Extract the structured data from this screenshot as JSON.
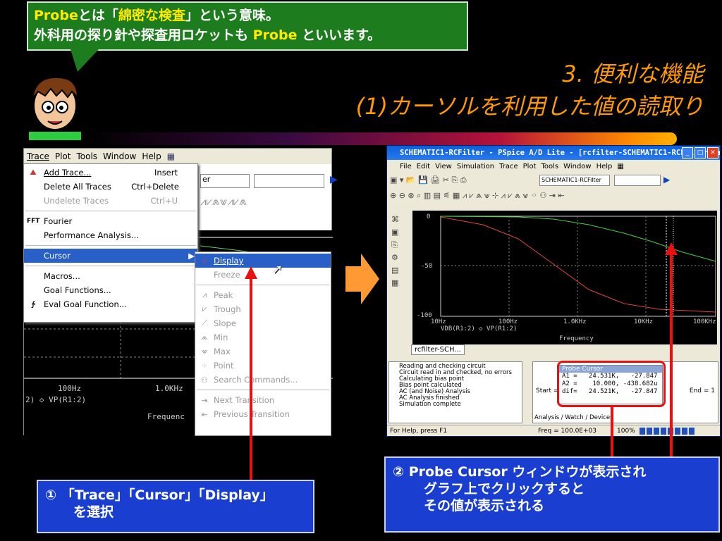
{
  "callout": {
    "line1_a": "Probe",
    "line1_b": "とは「",
    "line1_c": "綿密な検査",
    "line1_d": "」という意味。",
    "line2_a": "外科用の探り針や探査用ロケットも ",
    "line2_b": "Probe",
    "line2_c": " といいます。"
  },
  "title": {
    "line1": "3. 便利な機能",
    "line2": "(1)カーソルを利用した値の読取り"
  },
  "left_window": {
    "menubar": [
      "Trace",
      "Plot",
      "Tools",
      "Window",
      "Help"
    ],
    "menu": [
      {
        "label": "Add Trace...",
        "shortcut": "Insert",
        "icon": "add-trace-icon"
      },
      {
        "label": "Delete All Traces",
        "shortcut": "Ctrl+Delete"
      },
      {
        "label": "Undelete Traces",
        "shortcut": "Ctrl+U",
        "disabled": true
      },
      {
        "label": "Fourier",
        "icon": "fft-icon"
      },
      {
        "label": "Performance Analysis..."
      },
      {
        "label": "Cursor",
        "selected": true
      },
      {
        "label": "Macros..."
      },
      {
        "label": "Goal Functions..."
      },
      {
        "label": "Eval Goal Function...",
        "icon": "eval-icon"
      }
    ],
    "submenu": [
      "Display",
      "Freeze",
      "Peak",
      "Trough",
      "Slope",
      "Min",
      "Max",
      "Point",
      "Search Commands...",
      "Next Transition",
      "Previous Transition"
    ],
    "plot": {
      "x_ticks": [
        "100Hz",
        "1.0KHz"
      ],
      "legend": "2) ◇ VP(R1:2)",
      "xlabel": "Frequenc",
      "field": "er"
    }
  },
  "right_window": {
    "title": "SCHEMATIC1-RCFilter - PSpice A/D Lite - [rcfilter-SCHEMATIC1-RCFilter.dat (acti...",
    "menubar": [
      "File",
      "Edit",
      "View",
      "Simulation",
      "Trace",
      "Plot",
      "Tools",
      "Window",
      "Help"
    ],
    "profile": "SCHEMATIC1-RCFilter",
    "y_ticks": [
      "0",
      "-50",
      "-100"
    ],
    "x_ticks": [
      "10Hz",
      "100Hz",
      "1.0KHz",
      "10KHz",
      "100KHz"
    ],
    "legend": "VDB(R1:2) ◇ VP(R1:2)",
    "xlabel": "Frequency",
    "tab": "rcfilter-SCH...",
    "log": [
      "Reading and checking circuit",
      "Circuit read in and checked, no errors",
      "Calculating bias point",
      "Bias point calculated",
      "AC (and Noise) Analysis",
      "AC Analysis finished",
      "Simulation complete"
    ],
    "probe_cursor": {
      "title": "Probe Cursor",
      "rows": [
        "A1 =   24.531K,   -27.847",
        "A2 =    10.000, -438.682u",
        "dif=   24.521K,   -27.847"
      ]
    },
    "start": "Start =",
    "end": "End = 1",
    "bottom_tabs": "Analysis / Watch / Devices",
    "status": "For Help, press F1",
    "freq": "Freq = 100.0E+03",
    "zoom": "100%"
  },
  "box1": {
    "line1": "① 「Trace」「Cursor」「Display」",
    "line2": "を選択"
  },
  "box2": {
    "line1": "② Probe Cursor ウィンドウが表示され",
    "line2": "グラフ上でクリックすると",
    "line3": "その値が表示される"
  }
}
